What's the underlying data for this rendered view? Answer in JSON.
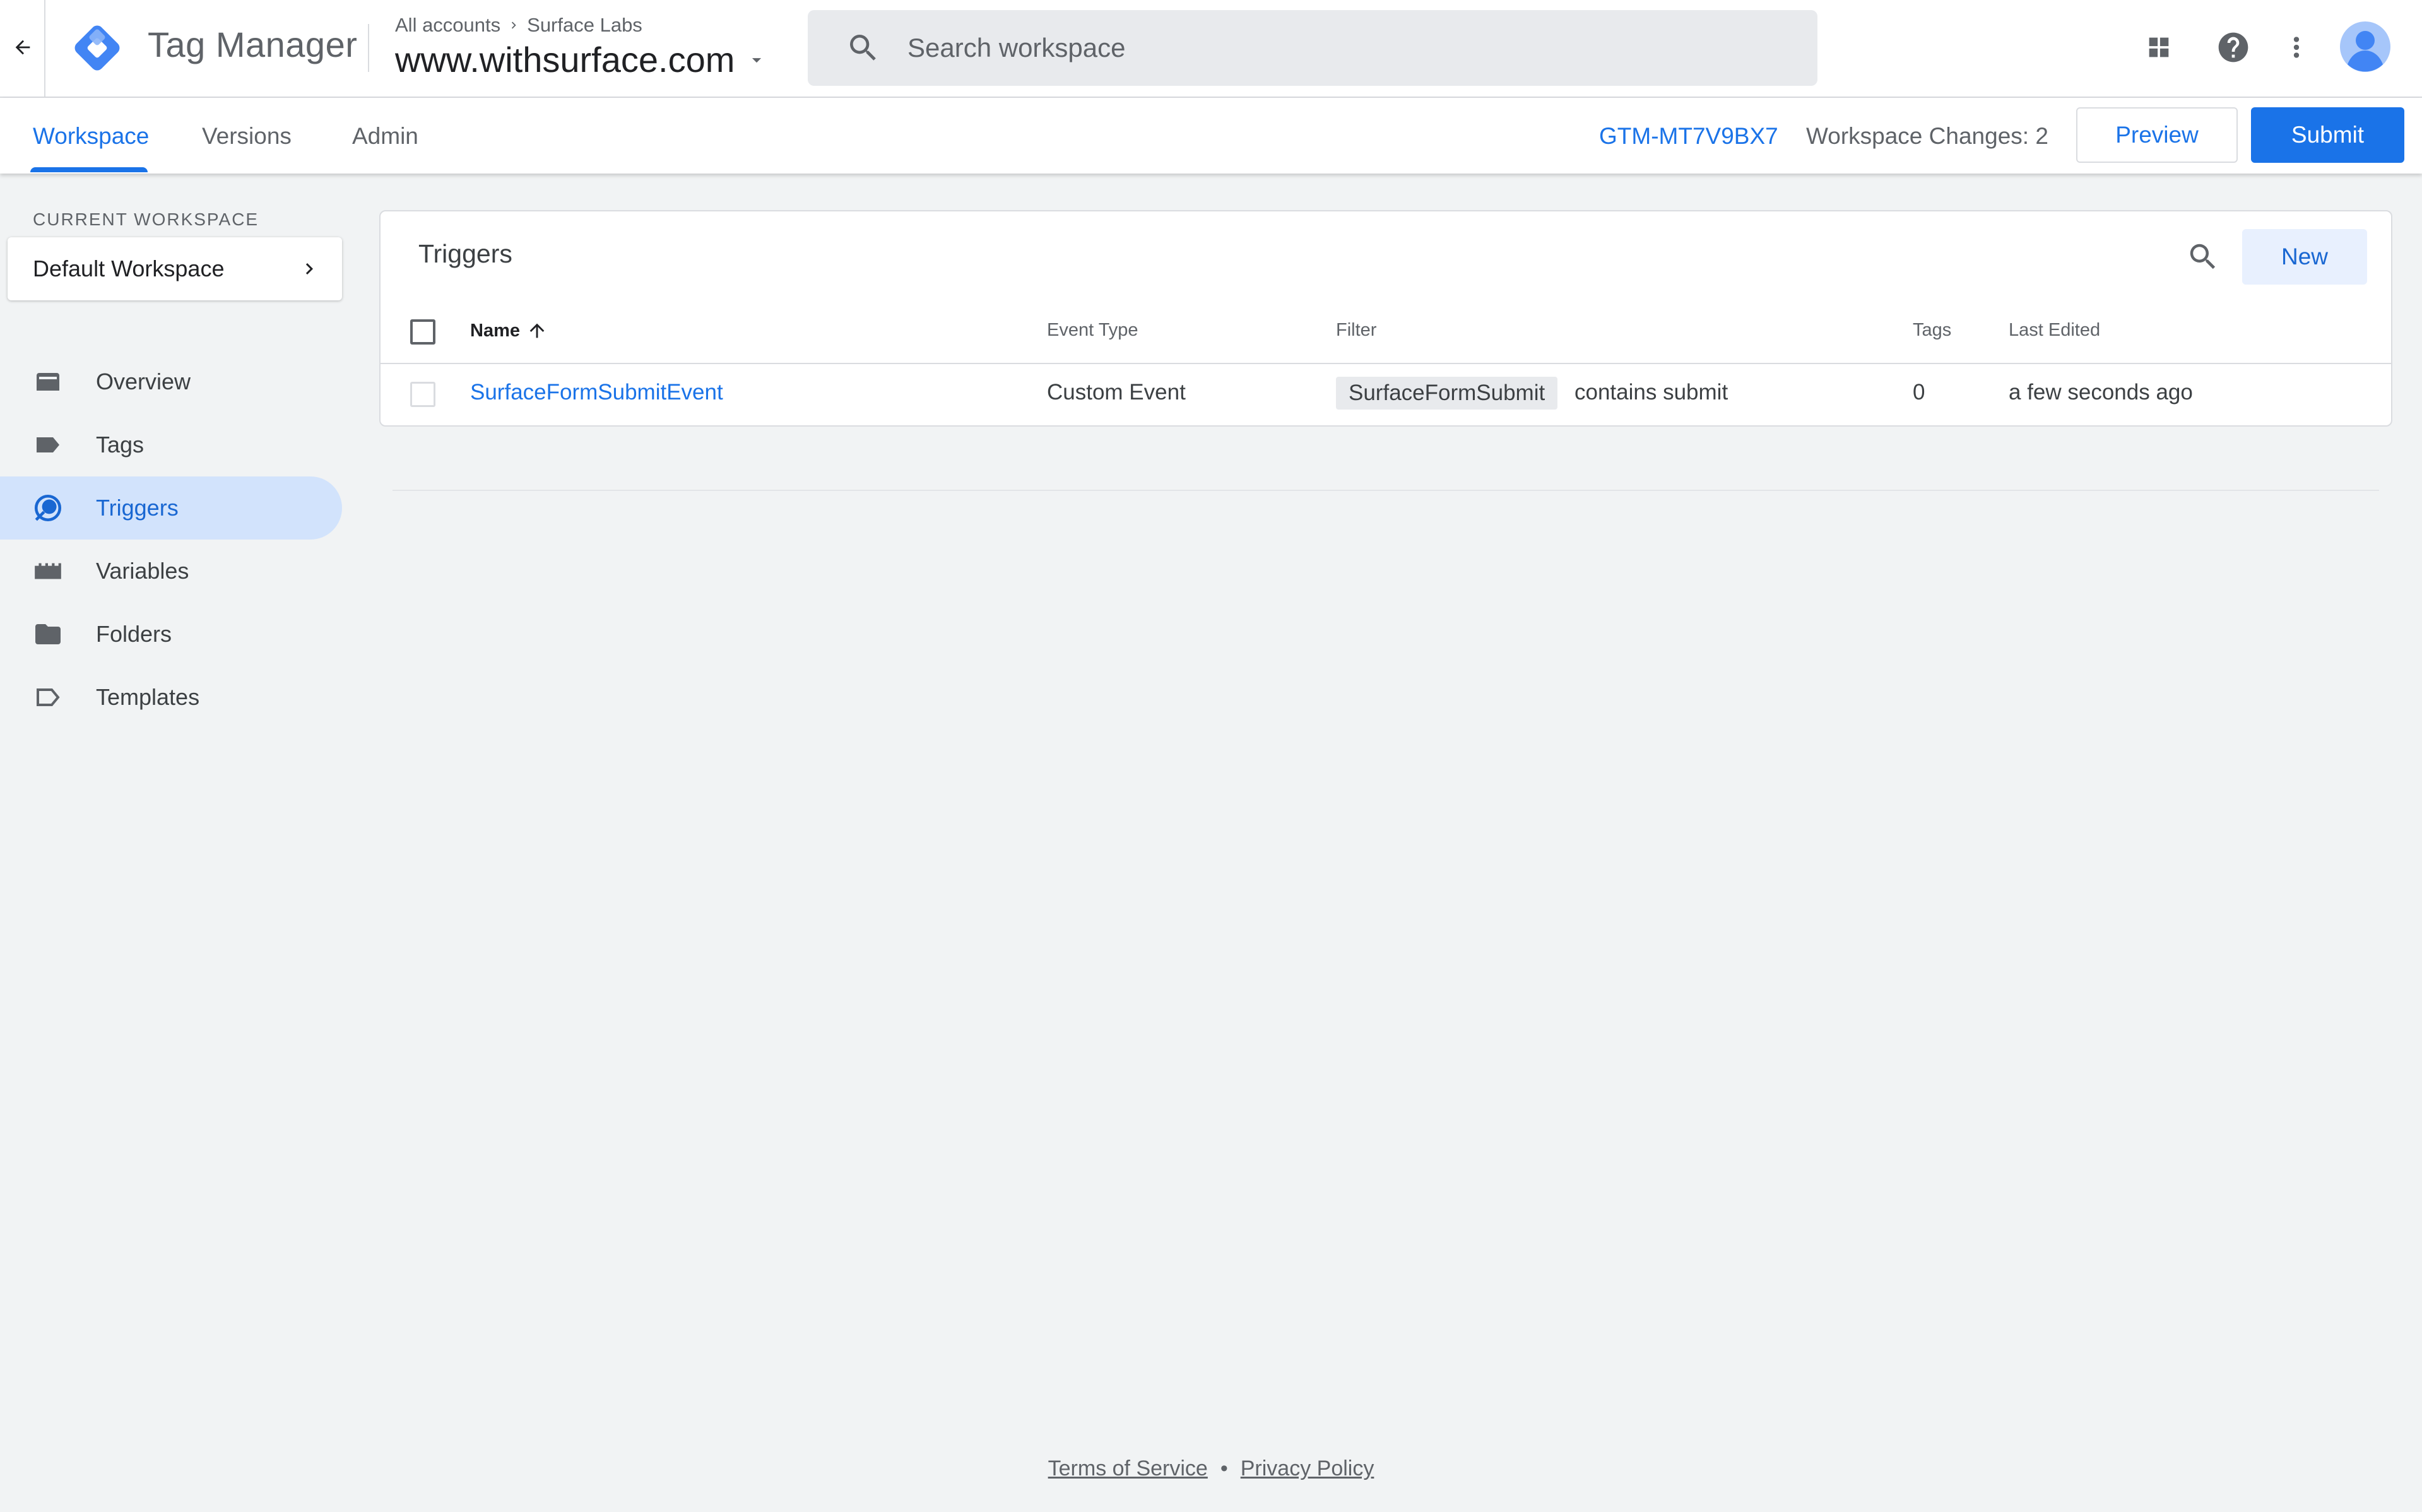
{
  "header": {
    "product_name": "Tag Manager",
    "breadcrumb": {
      "accounts": "All accounts",
      "account": "Surface Labs"
    },
    "container_name": "www.withsurface.com",
    "search_placeholder": "Search workspace",
    "icons": [
      "back-arrow-icon",
      "apps-grid-icon",
      "help-icon",
      "more-vert-icon",
      "account-avatar-icon"
    ]
  },
  "subnav": {
    "tabs": [
      {
        "label": "Workspace",
        "active": true
      },
      {
        "label": "Versions",
        "active": false
      },
      {
        "label": "Admin",
        "active": false
      }
    ],
    "container_id": "GTM-MT7V9BX7",
    "workspace_changes": "Workspace Changes: 2",
    "preview_label": "Preview",
    "submit_label": "Submit"
  },
  "sidebar": {
    "current_workspace_label": "CURRENT WORKSPACE",
    "workspace_name": "Default Workspace",
    "items": [
      {
        "label": "Overview",
        "icon": "overview-icon",
        "active": false
      },
      {
        "label": "Tags",
        "icon": "tag-icon",
        "active": false
      },
      {
        "label": "Triggers",
        "icon": "trigger-icon",
        "active": true
      },
      {
        "label": "Variables",
        "icon": "variables-icon",
        "active": false
      },
      {
        "label": "Folders",
        "icon": "folder-icon",
        "active": false
      },
      {
        "label": "Templates",
        "icon": "template-icon",
        "active": false
      }
    ]
  },
  "main": {
    "title": "Triggers",
    "new_label": "New",
    "columns": [
      "Name",
      "Event Type",
      "Filter",
      "Tags",
      "Last Edited"
    ],
    "rows": [
      {
        "name": "SurfaceFormSubmitEvent",
        "event_type": "Custom Event",
        "filter_variable": "SurfaceFormSubmit",
        "filter_condition": "contains submit",
        "tags": "0",
        "last_edited": "a few seconds ago"
      }
    ]
  },
  "footer": {
    "terms": "Terms of Service",
    "separator": "•",
    "privacy": "Privacy Policy"
  },
  "colors": {
    "accent": "#1a73e8",
    "active_nav_bg": "#d2e3fc",
    "page_bg": "#f1f3f4"
  }
}
